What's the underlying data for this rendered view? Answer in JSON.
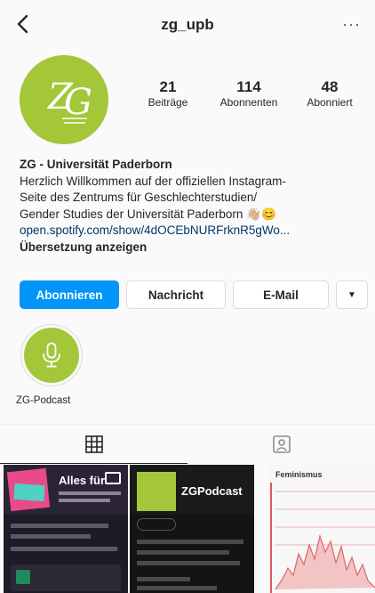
{
  "header": {
    "username": "zg_upb"
  },
  "profile": {
    "stats": [
      {
        "value": "21",
        "label": "Beiträge"
      },
      {
        "value": "114",
        "label": "Abonnenten"
      },
      {
        "value": "48",
        "label": "Abonniert"
      }
    ],
    "bio": {
      "name": "ZG - Universität Paderborn",
      "lines": [
        "Herzlich Willkommen auf der offiziellen Instagram-",
        "Seite des Zentrums für Geschlechterstudien/",
        "Gender Studies der Universität Paderborn 👋🏼😊"
      ],
      "link": "open.spotify.com/show/4dOCEbNURFrknR5gWo...",
      "translate": "Übersetzung anzeigen"
    }
  },
  "actions": {
    "follow": "Abonnieren",
    "message": "Nachricht",
    "email": "E-Mail"
  },
  "highlights": [
    {
      "label": "ZG-Podcast"
    }
  ],
  "posts": [
    {
      "title": "Alles für"
    },
    {
      "title": "ZGPodcast"
    },
    {
      "title": "Feminismus"
    }
  ],
  "colors": {
    "accent": "#0095f6",
    "brand_green": "#a4c639",
    "link": "#00376b"
  }
}
